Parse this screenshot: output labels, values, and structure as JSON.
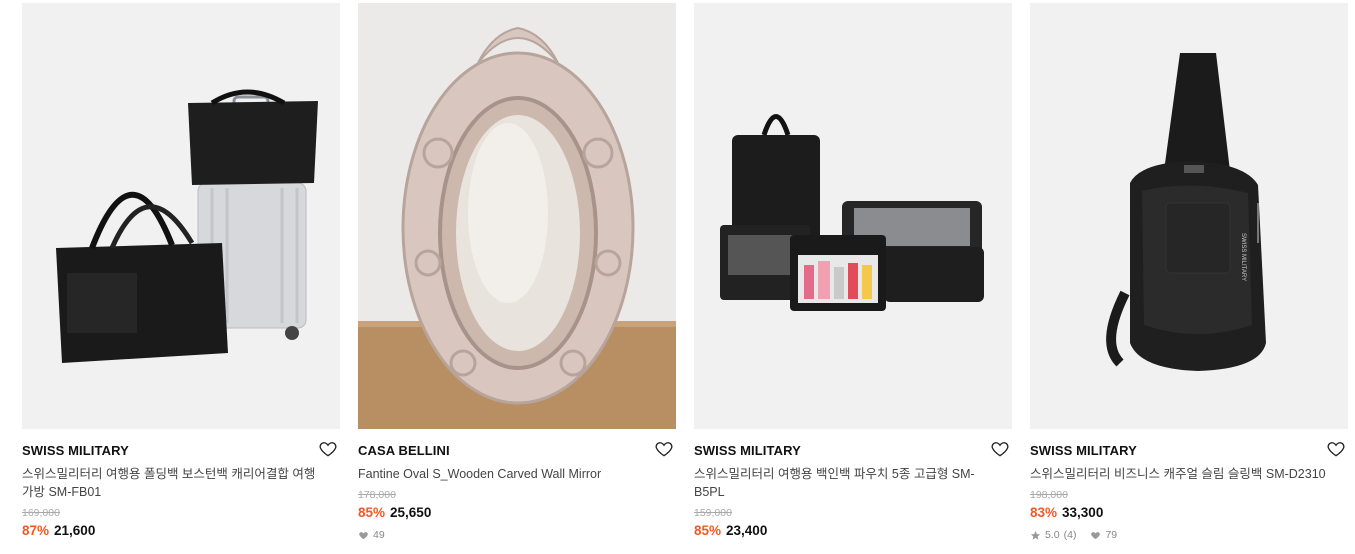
{
  "products": [
    {
      "brand": "SWISS MILITARY",
      "title": "스위스밀리터리 여행용 폴딩백 보스턴백 캐리어결합 여행가방 SM-FB01",
      "original_price": "169,000",
      "discount": "87%",
      "price": "21,600"
    },
    {
      "brand": "CASA BELLINI",
      "title": "Fantine Oval S_Wooden Carved Wall Mirror",
      "original_price": "178,000",
      "discount": "85%",
      "price": "25,650",
      "likes": "49"
    },
    {
      "brand": "SWISS MILITARY",
      "title": "스위스밀리터리 여행용 백인백 파우치 5종 고급형 SM-B5PL",
      "original_price": "159,000",
      "discount": "85%",
      "price": "23,400"
    },
    {
      "brand": "SWISS MILITARY",
      "title": "스위스밀리터리 비즈니스 캐주얼 슬림 슬링백 SM-D2310",
      "original_price": "198,000",
      "discount": "83%",
      "price": "33,300",
      "rating": "5.0",
      "reviews": "(4)",
      "likes": "79"
    }
  ],
  "icons": {
    "wishlist": "heart-outline-icon",
    "like": "heart-filled-icon",
    "rating": "star-icon"
  },
  "colors": {
    "discount": "#ef5a24",
    "background": "#f1f1f1"
  }
}
